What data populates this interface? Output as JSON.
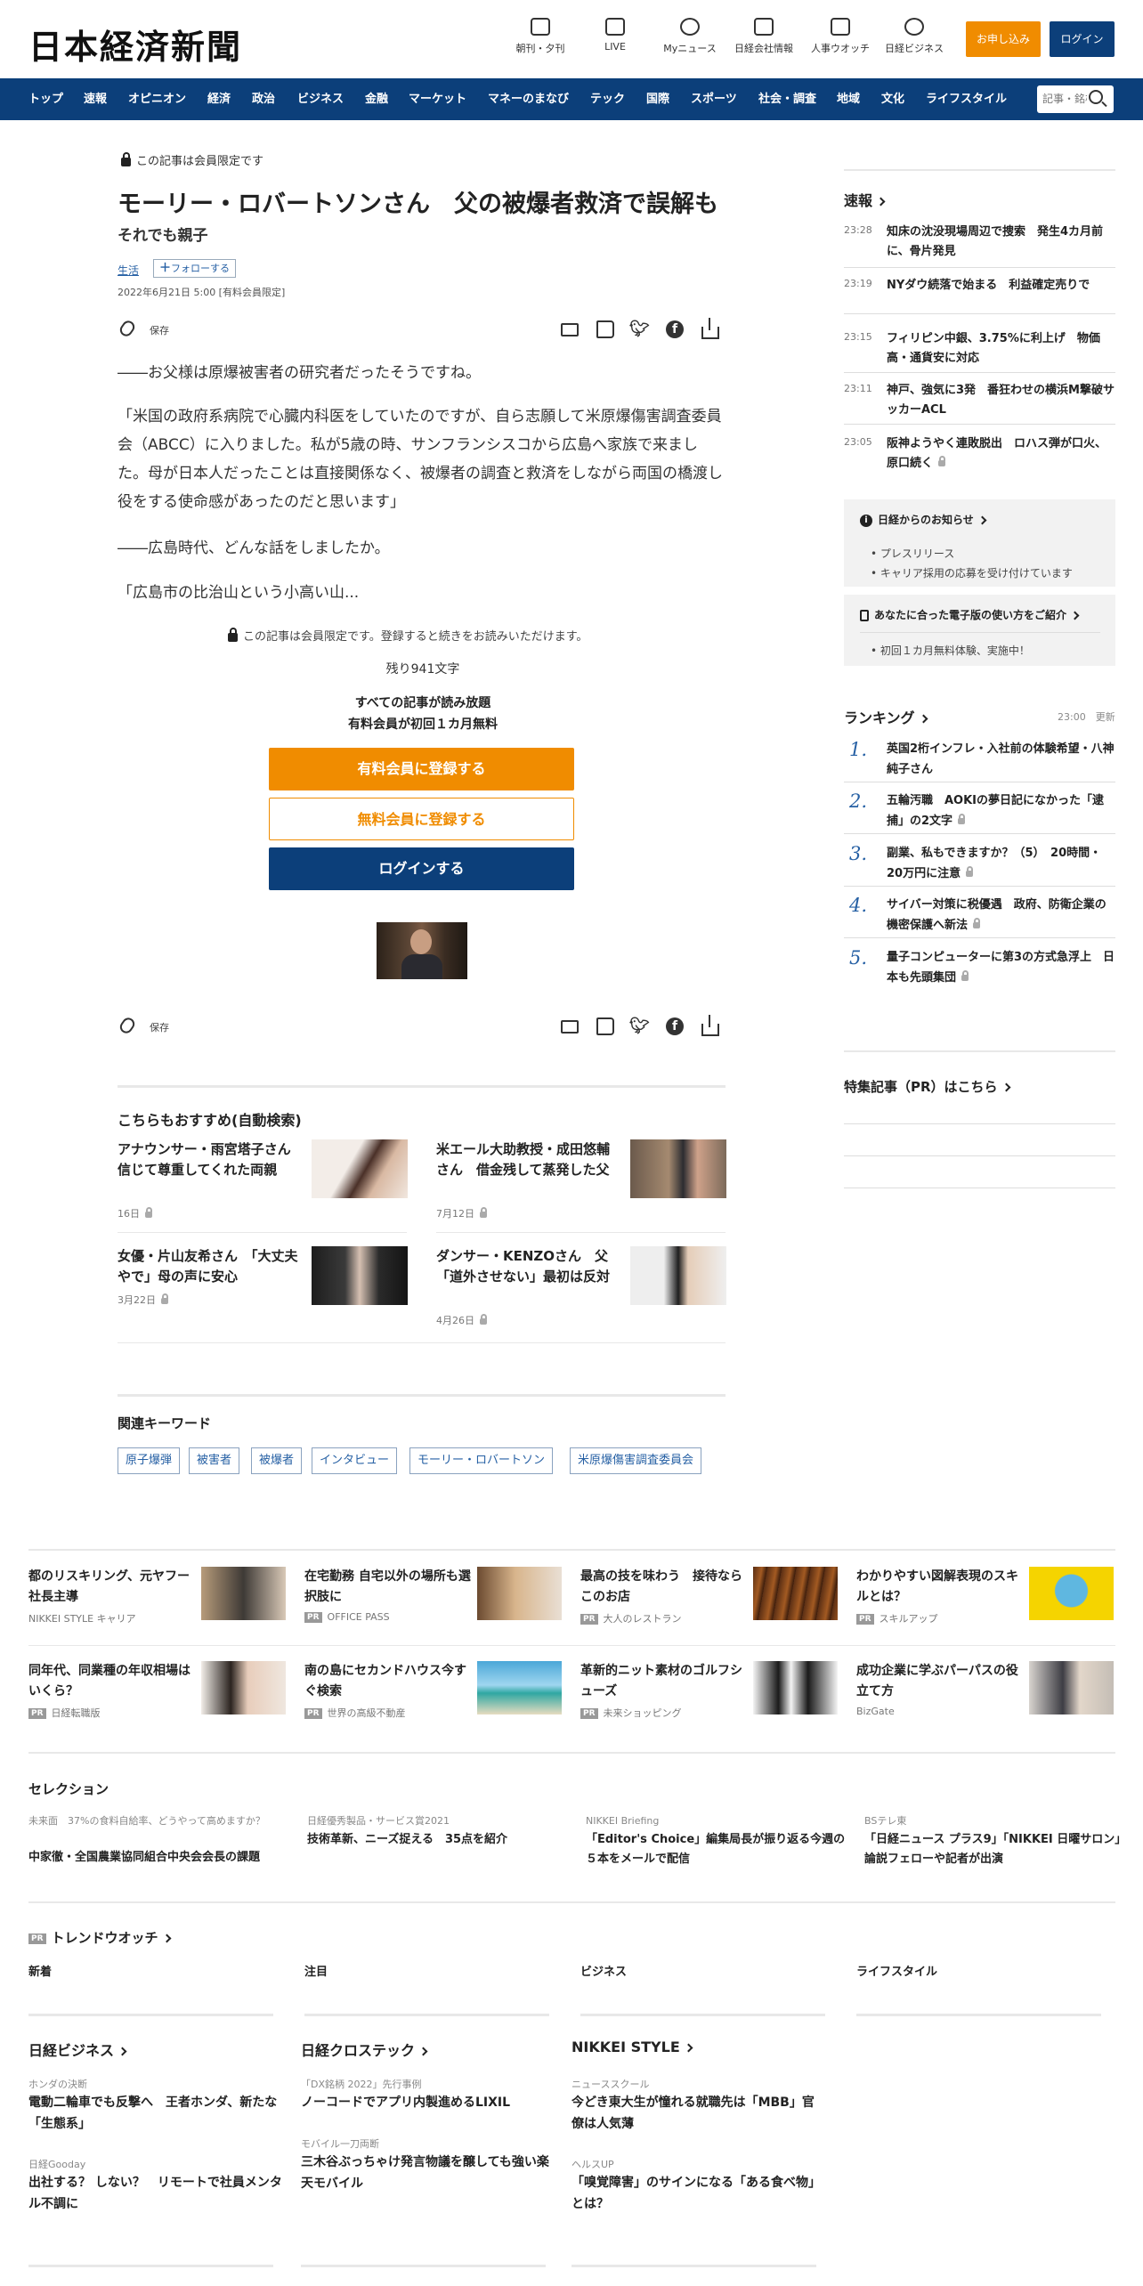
{
  "header": {
    "logo": "日本経済新聞",
    "icons": [
      {
        "label": "朝刊・夕刊",
        "icon": "newspaper-icon"
      },
      {
        "label": "LIVE",
        "icon": "video-icon"
      },
      {
        "label": "Myニュース",
        "icon": "user-icon"
      },
      {
        "label": "日経会社情報",
        "icon": "chart-icon"
      },
      {
        "label": "人事ウオッチ",
        "icon": "search-person-icon"
      },
      {
        "label": "日経ビジネス",
        "icon": "compass-icon"
      }
    ],
    "apply_label": "お申し込み",
    "login_label": "ログイン"
  },
  "nav": {
    "items": [
      "トップ",
      "速報",
      "オピニオン",
      "経済",
      "政治",
      "ビジネス",
      "金融",
      "マーケット",
      "マネーのまなび",
      "テック",
      "国際",
      "スポーツ",
      "社会・調査",
      "地域",
      "文化",
      "ライフスタイル"
    ],
    "search_placeholder": "記事・銘柄"
  },
  "article": {
    "member_only": "この記事は会員限定です",
    "title": "モーリー・ロバートソンさん　父の被爆者救済で誤解も",
    "subtitle": "それでも親子",
    "topic": "生活",
    "follow_label": "フォローする",
    "date": "2022年6月21日 5:00 [有料会員限定]",
    "save_label": "保存",
    "paragraphs": [
      "――お父様は原爆被害者の研究者だったそうですね。",
      "「米国の政府系病院で心臓内科医をしていたのですが、自ら志願して米原爆傷害調査委員会（ABCC）に入りました。私が5歳の時、サンフランシスコから広島へ家族で来ました。母が日本人だったことは直接関係なく、被爆者の調査と救済をしながら両国の橋渡し役をする使命感があったのだと思います」",
      "――広島時代、どんな話をしましたか。",
      "「広島市の比治山という小高い山..."
    ],
    "gate_note": "この記事は会員限定です。登録すると続きをお読みいただけます。",
    "remaining": "残り941文字",
    "gate_line1": "すべての記事が読み放題",
    "gate_line2": "有料会員が初回１カ月無料",
    "paid_btn": "有料会員に登録する",
    "free_btn": "無料会員に登録する",
    "login_btn": "ログインする"
  },
  "recommend": {
    "title": "こちらもおすすめ(自動検索)",
    "items": [
      {
        "title": "アナウンサー・雨宮塔子さん　信じて尊重してくれた両親",
        "date": "16日"
      },
      {
        "title": "米エール大助教授・成田悠輔さん　借金残して蒸発した父",
        "date": "7月12日"
      },
      {
        "title": "女優・片山友希さん　「大丈夫やで」母の声に安心",
        "date": "3月22日"
      },
      {
        "title": "ダンサー・KENZOさん　父「道外させない」最初は反対",
        "date": "4月26日"
      }
    ]
  },
  "keywords": {
    "title": "関連キーワード",
    "items": [
      "原子爆弾",
      "被害者",
      "被爆者",
      "インタビュー",
      "モーリー・ロバートソン",
      "米原爆傷害調査委員会"
    ]
  },
  "sidebar": {
    "news_title": "速報",
    "news": [
      {
        "time": "23:28",
        "headline": "知床の沈没現場周辺で捜索　発生4カ月前に、骨片発見"
      },
      {
        "time": "23:19",
        "headline": "NYダウ続落で始まる　利益確定売りで"
      },
      {
        "time": "23:15",
        "headline": "フィリピン中銀、3.75%に利上げ　物価高・通貨安に対応"
      },
      {
        "time": "23:11",
        "headline": "神戸、強気に3発　番狂わせの横浜M撃破サッカーACL"
      },
      {
        "time": "23:05",
        "headline": "阪神ようやく連敗脱出　ロハス弾が口火、原口続く"
      }
    ],
    "notice_title": "日経からのお知らせ",
    "notice_items": [
      "プレスリリース",
      "キャリア採用の応募を受け付けています"
    ],
    "guide_title": "あなたに合った電子版の使い方をご紹介",
    "guide_items": [
      "初回１カ月無料体験、実施中！"
    ],
    "ranking_title": "ランキング",
    "ranking_time": "23:00　更新",
    "ranking": [
      {
        "rank": "1.",
        "headline": "英国2桁インフレ・入社前の体験希望・八神純子さん"
      },
      {
        "rank": "2.",
        "headline": "五輪汚職　AOKIの夢日記になかった「逮捕」の2文字"
      },
      {
        "rank": "3.",
        "headline": "副業、私もできますか？（5）　20時間・20万円に注意"
      },
      {
        "rank": "4.",
        "headline": "サイバー対策に税優遇　政府、防衛企業の機密保護へ新法"
      },
      {
        "rank": "5.",
        "headline": "量子コンピューターに第3の方式急浮上　日本も先頭集団"
      }
    ],
    "pr_title": "特集記事（PR）はこちら"
  },
  "ads": [
    {
      "title": "都のリスキリング、元ヤフー社長主導",
      "source": "NIKKEI STYLE キャリア",
      "pr": false
    },
    {
      "title": "在宅勤務 自宅以外の場所も選択肢に",
      "source": "OFFICE PASS",
      "pr": true
    },
    {
      "title": "最高の技を味わう　接待ならこのお店",
      "source": "大人のレストラン",
      "pr": true
    },
    {
      "title": "わかりやすい図解表現のスキルとは？",
      "source": "スキルアップ",
      "pr": true
    },
    {
      "title": "同年代、同業種の年収相場はいくら？",
      "source": "日経転職版",
      "pr": true
    },
    {
      "title": "南の島にセカンドハウス今すぐ検索",
      "source": "世界の高級不動産",
      "pr": true
    },
    {
      "title": "革新的ニット素材のゴルフシューズ",
      "source": "未来ショッピング",
      "pr": true
    },
    {
      "title": "成功企業に学ぶパーパスの役立て方",
      "source": "BizGate",
      "pr": false
    }
  ],
  "pr_label": "PR",
  "selection": {
    "title": "セレクション",
    "items": [
      {
        "sub": "未来面　37%の食料自給率、どうやって高めますか？",
        "title": "中家徹・全国農業協同組合中央会会長の課題"
      },
      {
        "sub": "日経優秀製品・サービス賞2021",
        "title": "技術革新、ニーズ捉える　35点を紹介"
      },
      {
        "sub": "NIKKEI Briefing",
        "title": "「Editor's Choice」編集局長が振り返る今週の５本をメールで配信"
      },
      {
        "sub": "BSテレ東",
        "title": "「日経ニュース プラス9」「NIKKEI 日曜サロン」論説フェローや記者が出演"
      }
    ]
  },
  "trend": {
    "title": "トレンドウオッチ",
    "tabs": [
      "新着",
      "注目",
      "ビジネス",
      "ライフスタイル"
    ]
  },
  "brands": [
    {
      "name": "日経ビジネス",
      "items": [
        {
          "sub": "ホンダの決断",
          "title": "電動二輪車でも反撃へ　王者ホンダ、新たな「生態系」"
        },
        {
          "sub": "日経Gooday",
          "title": "出社する？ しない？　リモートで社員メンタル不調に"
        }
      ]
    },
    {
      "name": "日経クロステック",
      "items": [
        {
          "sub": "「DX銘柄 2022」先行事例",
          "title": "ノーコードでアプリ内製進めるLIXIL"
        },
        {
          "sub": "モバイル一刀両断",
          "title": "三木谷ぶっちゃけ発言物議を醸しても強い楽天モバイル"
        }
      ]
    },
    {
      "name": "NIKKEI STYLE",
      "items": [
        {
          "sub": "ニューススクール",
          "title": "今どき東大生が憧れる就職先は「MBB」官僚は人気薄"
        },
        {
          "sub": "ヘルスUP",
          "title": "「嗅覚障害」のサインになる「ある食べ物」とは？"
        }
      ]
    }
  ]
}
